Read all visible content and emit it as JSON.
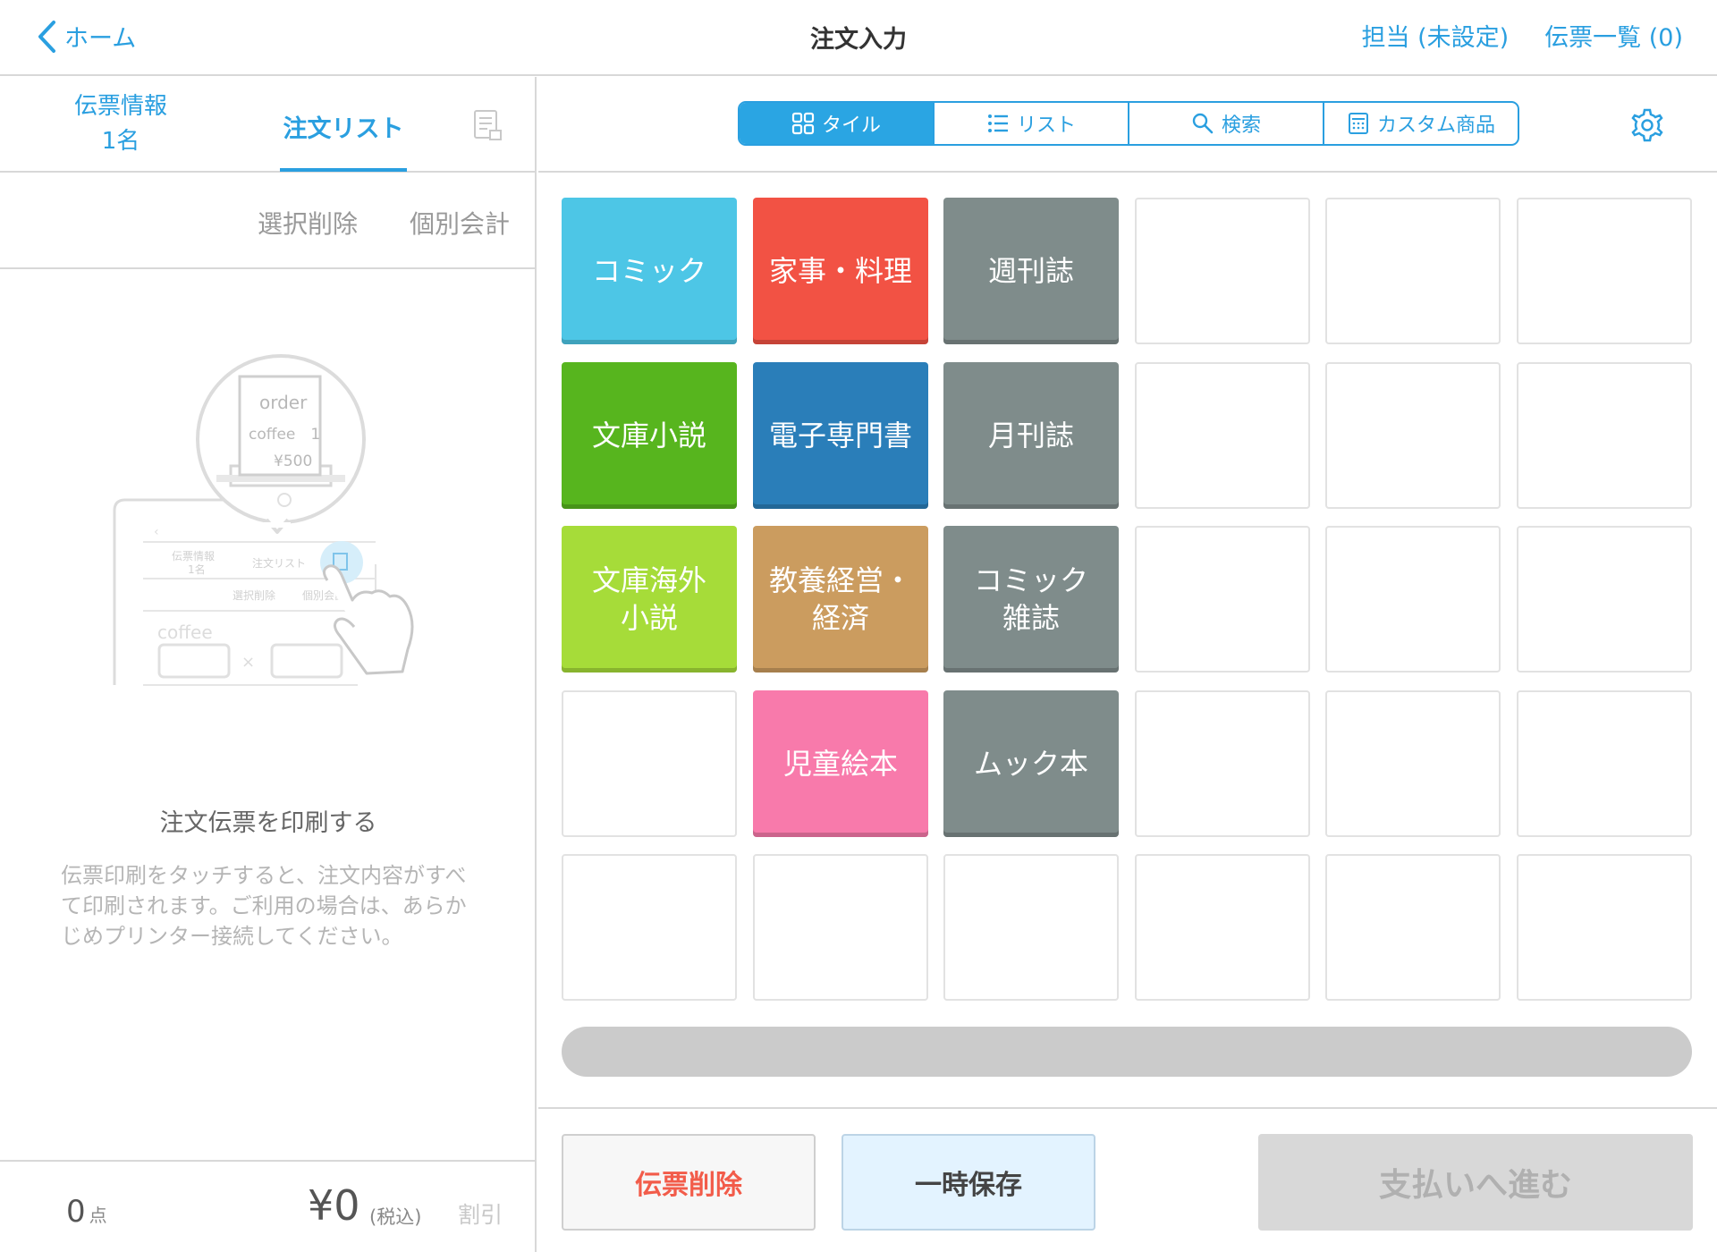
{
  "header": {
    "back_label": "ホーム",
    "title": "注文入力",
    "staff_label": "担当 (未設定)",
    "slip_list_label": "伝票一覧 (0)"
  },
  "left_panel": {
    "tab_info_line1": "伝票情報",
    "tab_info_line2": "1名",
    "tab_order": "注文リスト",
    "action_select_delete": "選択削除",
    "action_split_pay": "個別会計",
    "empty_title": "注文伝票を印刷する",
    "empty_desc": "伝票印刷をタッチすると、注文内容がすべて印刷されます。ご利用の場合は、あらかじめプリンター接続してください。",
    "illustration": {
      "order": "order",
      "coffee_line": "coffee　1",
      "price": "¥500",
      "mini_info": "伝票情報",
      "mini_info_count": "1名",
      "mini_order": "注文リスト",
      "mini_select_delete": "選択削除",
      "mini_split": "個別会計",
      "mini_item": "coffee",
      "mini_times": "×"
    },
    "footer": {
      "count_value": "0",
      "count_unit": "点",
      "total": "¥0",
      "tax_note": "(税込)",
      "discount": "割引"
    }
  },
  "view_switch": {
    "tile": "タイル",
    "list": "リスト",
    "search": "検索",
    "custom": "カスタム商品"
  },
  "tiles": [
    {
      "row": 0,
      "col": 0,
      "label": "コミック",
      "color": "#4dc6e6"
    },
    {
      "row": 0,
      "col": 1,
      "label": "家事・料理",
      "color": "#f25244"
    },
    {
      "row": 0,
      "col": 2,
      "label": "週刊誌",
      "color": "#7f8c8b"
    },
    {
      "row": 1,
      "col": 0,
      "label": "文庫小説",
      "color": "#57b51e"
    },
    {
      "row": 1,
      "col": 1,
      "label": "電子専門書",
      "color": "#2a7eb9"
    },
    {
      "row": 1,
      "col": 2,
      "label": "月刊誌",
      "color": "#7f8c8b"
    },
    {
      "row": 2,
      "col": 0,
      "label": "文庫海外\n小説",
      "color": "#a6dc39"
    },
    {
      "row": 2,
      "col": 1,
      "label": "教養経営・\n経済",
      "color": "#cb9c5f"
    },
    {
      "row": 2,
      "col": 2,
      "label": "コミック\n雑誌",
      "color": "#7f8c8b"
    },
    {
      "row": 3,
      "col": 1,
      "label": "児童絵本",
      "color": "#f87aab"
    },
    {
      "row": 3,
      "col": 2,
      "label": "ムック本",
      "color": "#7f8c8b"
    }
  ],
  "footer_buttons": {
    "delete_slip": "伝票削除",
    "temp_save": "一時保存",
    "proceed_payment": "支払いへ進む"
  },
  "colors": {
    "accent": "#2a9fe0",
    "delete": "#f25c4a"
  }
}
